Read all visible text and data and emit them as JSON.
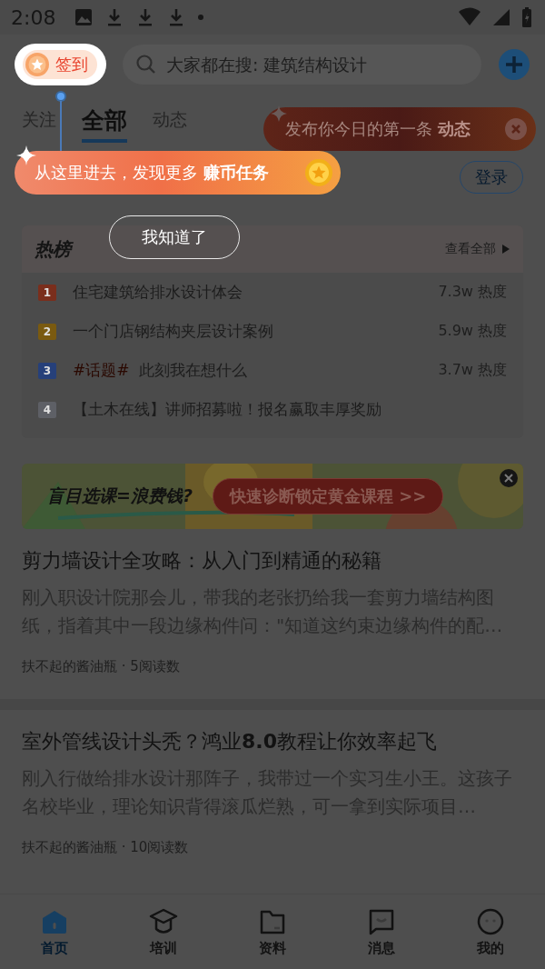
{
  "status_bar": {
    "time": "2:08"
  },
  "sign_in": {
    "label": "签到"
  },
  "search": {
    "placeholder": "大家都在搜: 建筑结构设计"
  },
  "tabs": [
    {
      "label": "关注",
      "selected": false
    },
    {
      "label": "全部",
      "selected": true
    },
    {
      "label": "动态",
      "selected": false
    }
  ],
  "post_tip": {
    "text": "发布你今日的第一条 **动态**"
  },
  "guide_tip": {
    "text": "从这里进去，发现更多 **赚币任务**"
  },
  "login_button": "登录",
  "guide_button": "我知道了",
  "hot_list": {
    "title": "热榜",
    "more": "查看全部",
    "items": [
      {
        "rank": "1",
        "color": "#7a2e1c",
        "title": "住宅建筑给排水设计体会",
        "heat": "7.3w 热度"
      },
      {
        "rank": "2",
        "color": "#7a5a10",
        "title": "一个门店钢结构夹层设计案例",
        "heat": "5.9w 热度"
      },
      {
        "rank": "3",
        "color": "#26407a",
        "tag": "#话题#",
        "title": "此刻我在想什么",
        "heat": "3.7w 热度"
      },
      {
        "rank": "4",
        "color": "#5e6066",
        "title": "【土木在线】讲师招募啦！报名赢取丰厚奖励"
      }
    ]
  },
  "ad": {
    "headline": "盲目选课=浪费钱?",
    "button": "快速诊断锁定黄金课程 >>"
  },
  "articles": [
    {
      "title": "剪力墙设计全攻略：从入门到精通的秘籍",
      "summary": "刚入职设计院那会儿，带我的老张扔给我一套剪力墙结构图纸，指着其中一段边缘构件问：\"知道这约束边缘构件的配…",
      "meta": "扶不起的酱油瓶 · 5阅读数"
    },
    {
      "title": "室外管线设计头秃？鸿业**8.0**教程让你效率起飞",
      "summary": "刚入行做给排水设计那阵子，我带过一个实习生小王。这孩子名校毕业，理论知识背得滚瓜烂熟，可一拿到实际项目…",
      "meta": "扶不起的酱油瓶 · 10阅读数"
    }
  ],
  "nav": [
    {
      "label": "首页",
      "selected": true
    },
    {
      "label": "培训",
      "selected": false
    },
    {
      "label": "资料",
      "selected": false
    },
    {
      "label": "消息",
      "selected": false
    },
    {
      "label": "我的",
      "selected": false
    }
  ]
}
